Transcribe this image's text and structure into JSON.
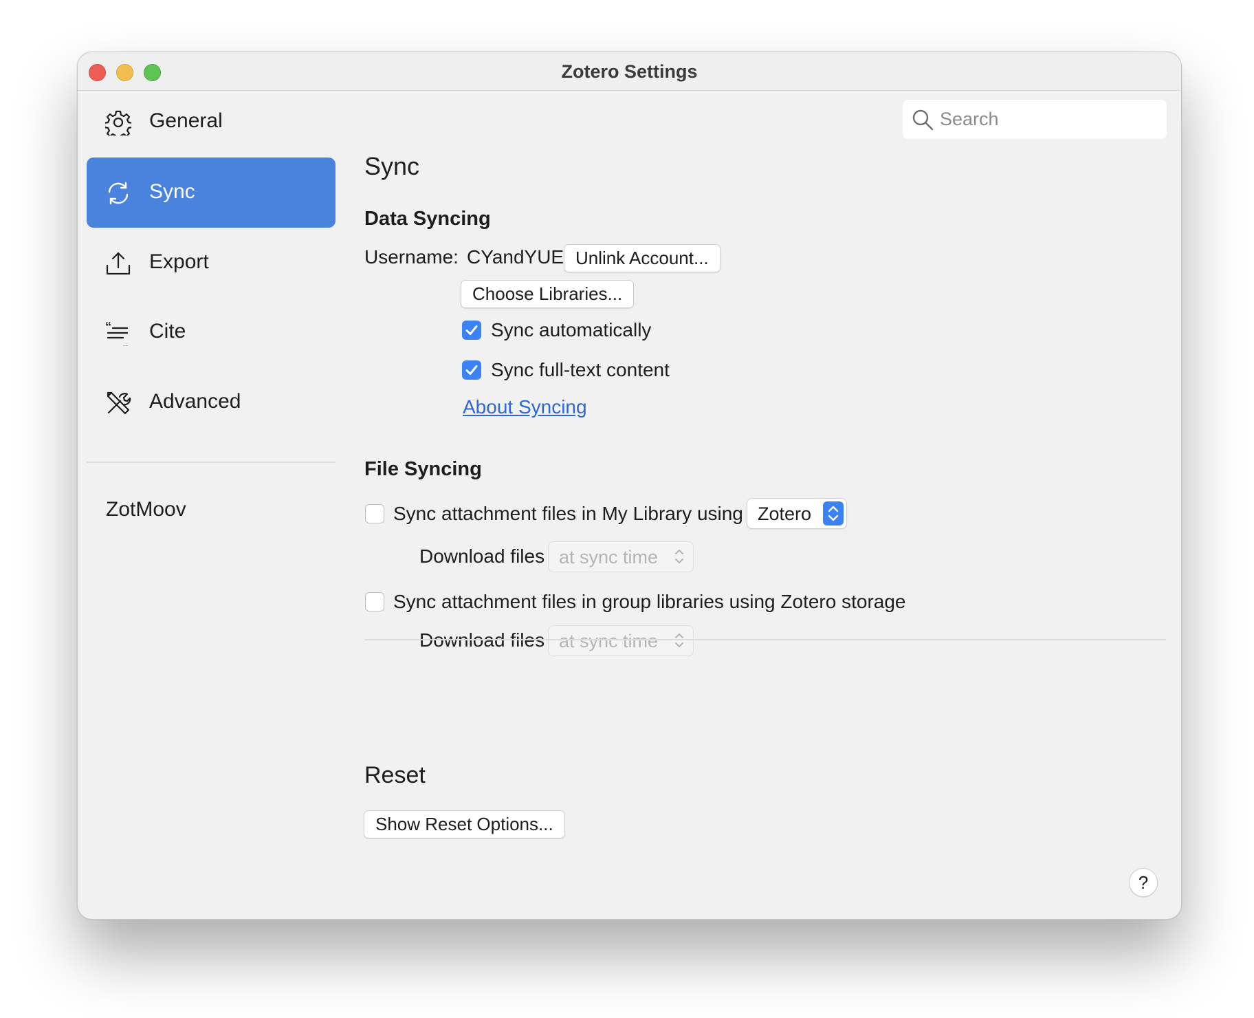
{
  "window": {
    "title": "Zotero Settings"
  },
  "search": {
    "placeholder": "Search"
  },
  "sidebar": {
    "items": [
      {
        "label": "General",
        "icon": "gear-icon"
      },
      {
        "label": "Sync",
        "icon": "sync-icon",
        "active": true
      },
      {
        "label": "Export",
        "icon": "export-icon"
      },
      {
        "label": "Cite",
        "icon": "cite-icon"
      },
      {
        "label": "Advanced",
        "icon": "tools-icon"
      }
    ],
    "plugins": [
      {
        "label": "ZotMoov"
      }
    ]
  },
  "main": {
    "page_title": "Sync",
    "data_syncing": {
      "heading": "Data Syncing",
      "username_label": "Username:",
      "username_value": "CYandYUE",
      "unlink_button": "Unlink Account...",
      "choose_libraries_button": "Choose Libraries...",
      "sync_automatically": {
        "label": "Sync automatically",
        "checked": true
      },
      "sync_fulltext": {
        "label": "Sync full-text content",
        "checked": true
      },
      "about_link": "About Syncing"
    },
    "file_syncing": {
      "heading": "File Syncing",
      "my_library": {
        "label": "Sync attachment files in My Library using",
        "checked": false,
        "service": "Zotero",
        "download_label": "Download files",
        "download_value": "at sync time"
      },
      "group_libraries": {
        "label": "Sync attachment files in group libraries using Zotero storage",
        "checked": false,
        "download_label": "Download files",
        "download_value": "at sync time"
      }
    },
    "reset": {
      "heading": "Reset",
      "button": "Show Reset Options..."
    },
    "help": "?"
  },
  "colors": {
    "accent": "#4a83dd",
    "checkbox": "#3b82f6",
    "link": "#2c66d8"
  }
}
